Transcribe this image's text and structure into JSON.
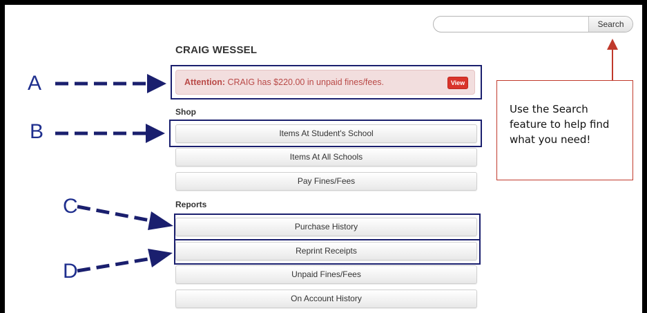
{
  "search": {
    "placeholder": "",
    "value": "",
    "button_label": "Search"
  },
  "student": {
    "name": "CRAIG WESSEL"
  },
  "alert": {
    "prefix": "Attention:",
    "message": " CRAIG has $220.00 in unpaid fines/fees.",
    "view_label": "View"
  },
  "shop": {
    "heading": "Shop",
    "items": [
      {
        "label": "Items At Student's School"
      },
      {
        "label": "Items At All Schools"
      },
      {
        "label": "Pay Fines/Fees"
      }
    ]
  },
  "reports": {
    "heading": "Reports",
    "items": [
      {
        "label": "Purchase History"
      },
      {
        "label": "Reprint Receipts"
      },
      {
        "label": "Unpaid Fines/Fees"
      },
      {
        "label": "On Account History"
      }
    ]
  },
  "annotations": {
    "letters": {
      "a": "A",
      "b": "B",
      "c": "C",
      "d": "D"
    },
    "callout_text": "Use the Search feature to help find what you need!"
  },
  "colors": {
    "annotation_navy": "#1a1f6e",
    "arrow_red": "#c0392b",
    "alert_bg": "#f2dede",
    "alert_text": "#b94a48",
    "view_button": "#d9342b"
  }
}
